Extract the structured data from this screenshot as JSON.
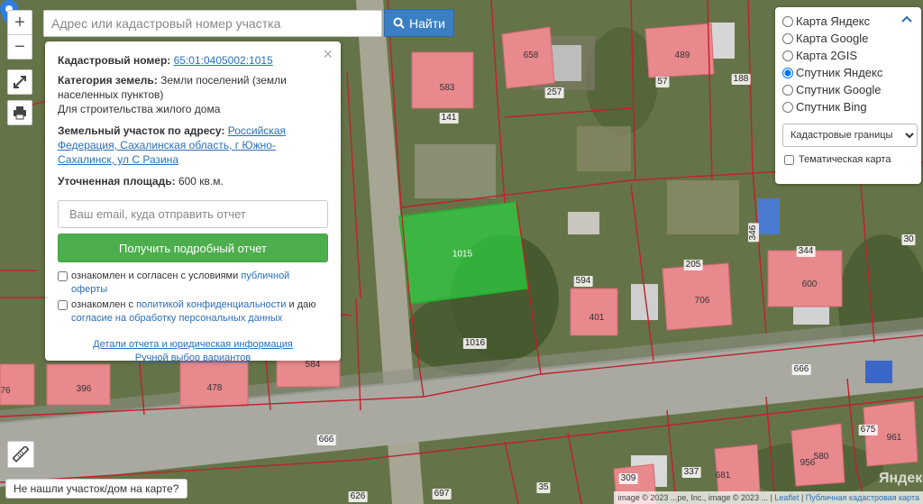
{
  "search": {
    "placeholder": "Адрес или кадастровый номер участка",
    "button_label": "Найти"
  },
  "zoom": {
    "in_label": "+",
    "out_label": "−"
  },
  "info": {
    "cadastral_label": "Кадастровый номер:",
    "cadastral_value": "65:01:0405002:1015",
    "category_label": "Категория земель:",
    "category_value": "Земли поселений (земли населенных пунктов)",
    "usage_value": "Для строительства жилого дома",
    "address_label": "Земельный участок по адресу:",
    "address_value": "Российская Федерация, Сахалинская область, г Южно-Сахалинск, ул С Разина",
    "area_label": "Уточненная площадь:",
    "area_value": "600 кв.м.",
    "email_placeholder": "Ваш email, куда отправить отчет",
    "report_button": "Получить подробный отчет",
    "check1_text": "ознакомлен и согласен с условиями ",
    "check1_link": "публичной оферты",
    "check2_text": "ознакомлен с ",
    "check2_link": "политикой конфиденциальности",
    "check2_mid": " и даю",
    "check2_link2": "согласие на обработку персональных данных",
    "details_link": "Детали отчета и юридическая информация",
    "manual_link": "Ручной выбор вариантов",
    "close_label": "×"
  },
  "layers": {
    "options": [
      "Карта Яндекс",
      "Карта Google",
      "Карта 2GIS",
      "Спутник Яндекс",
      "Спутник Google",
      "Спутник Bing"
    ],
    "selected": "Спутник Яндекс",
    "select_value": "Кадастровые границы",
    "thematic_label": "Тематическая карта"
  },
  "selected_parcel": "1015",
  "lot_numbers": [
    "583",
    "141",
    "658",
    "257",
    "489",
    "57",
    "188",
    "594",
    "401",
    "205",
    "706",
    "344",
    "600",
    "346",
    "30",
    "1016",
    "666",
    "666",
    "396",
    "478",
    "584",
    "76",
    "309",
    "955",
    "337",
    "681",
    "956",
    "580",
    "961",
    "675",
    "697",
    "35",
    "626"
  ],
  "not_found_label": "Не нашли участок/дом на карте?",
  "attribution": {
    "images": "image © 2023 ...pe, Inc., image © 2023 ...",
    "leaflet": "Leaflet",
    "cadastral_map": "Публичная кадастровая карта"
  },
  "watermark": "Яндекс",
  "colors": {
    "selected_parcel": "#2ecc40",
    "building_fill": "#e8898d",
    "boundary": "#c0202a",
    "search_button": "#3a7fc2",
    "report_button": "#4cae4c"
  }
}
